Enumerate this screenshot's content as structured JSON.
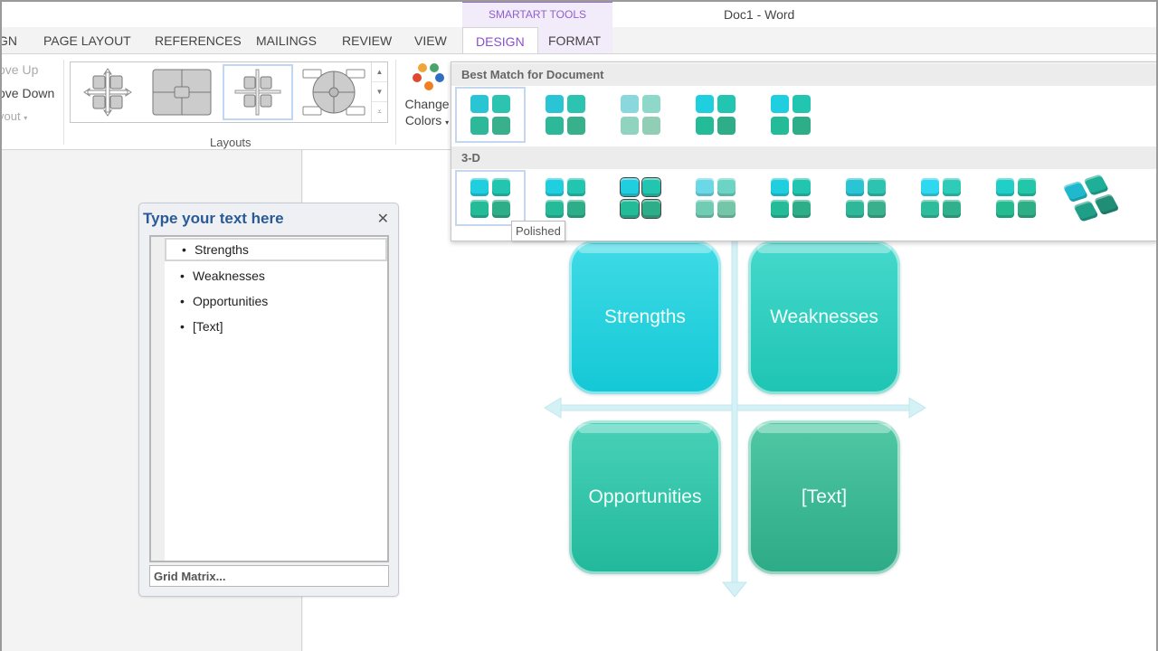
{
  "window": {
    "title": "Doc1 - Word"
  },
  "contextual_tab_group": {
    "label": "SMARTART TOOLS",
    "color": "#8f5fce"
  },
  "tabs": [
    {
      "label": "GN",
      "active": false
    },
    {
      "label": "PAGE LAYOUT",
      "active": false
    },
    {
      "label": "REFERENCES",
      "active": false
    },
    {
      "label": "MAILINGS",
      "active": false
    },
    {
      "label": "REVIEW",
      "active": false
    },
    {
      "label": "VIEW",
      "active": false
    },
    {
      "label": "DESIGN",
      "active": true
    },
    {
      "label": "FORMAT",
      "active": false
    }
  ],
  "ribbon": {
    "create_graphic": {
      "move_up": "ove Up",
      "move_down": "ove Down",
      "layout": "yout"
    },
    "layouts": {
      "label": "Layouts",
      "items": [
        {
          "name": "Cycle Matrix",
          "selected": false
        },
        {
          "name": "Grid layout with center",
          "selected": false
        },
        {
          "name": "Grid Matrix",
          "selected": true
        },
        {
          "name": "Circular layout",
          "selected": false
        }
      ]
    },
    "change_colors": {
      "line1": "Change",
      "line2": "Colors",
      "dot_colors": [
        "#f0a53c",
        "#4aa36b",
        "#dd4a2e",
        "#2f6fbf",
        "#ef7f22"
      ]
    }
  },
  "colors_dropdown": {
    "sections": [
      {
        "title": "Best Match for Document",
        "items": [
          {
            "style": "Flat",
            "selected": true,
            "colors": [
              "#29c5d4",
              "#2cc4b0",
              "#2eb89a",
              "#38b08c"
            ]
          },
          {
            "style": "Flat light",
            "selected": false,
            "colors": [
              "#29c5d4",
              "#2cc4b0",
              "#2eb89a",
              "#38b08c"
            ]
          },
          {
            "style": "Muted",
            "selected": false,
            "colors": [
              "#8ad8de",
              "#8dd8c8",
              "#90d4c0",
              "#92ceb6"
            ]
          },
          {
            "style": "Gradient",
            "selected": false,
            "colors": [
              "#1fcfe0",
              "#22c6b0",
              "#24bb98",
              "#2eae88"
            ]
          },
          {
            "style": "Shadow",
            "selected": false,
            "colors": [
              "#1fcfe0",
              "#22c6b0",
              "#24bb98",
              "#2eae88"
            ]
          }
        ]
      },
      {
        "title": "3-D",
        "items": [
          {
            "style": "Polished",
            "selected": true,
            "colors": [
              "#1fcfe0",
              "#22c6b0",
              "#24bb98",
              "#2eae88"
            ]
          },
          {
            "style": "Inset",
            "selected": false,
            "colors": [
              "#1fcfe0",
              "#22c6b0",
              "#24bb98",
              "#2eae88"
            ]
          },
          {
            "style": "Cartoon",
            "selected": false,
            "colors": [
              "#1fcfe0",
              "#22c6b0",
              "#24bb98",
              "#2eae88"
            ]
          },
          {
            "style": "Powder",
            "selected": false,
            "colors": [
              "#6ad8e6",
              "#6bd4c4",
              "#70ccb2",
              "#74c6a8"
            ]
          },
          {
            "style": "Brick Scene",
            "selected": false,
            "colors": [
              "#1fcfe0",
              "#22c6b0",
              "#24bb98",
              "#2eae88"
            ]
          },
          {
            "style": "Sunset Scene",
            "selected": false,
            "colors": [
              "#29c5d4",
              "#2cc4b0",
              "#2eb89a",
              "#38b08c"
            ]
          },
          {
            "style": "Metallic",
            "selected": false,
            "colors": [
              "#2ed8ee",
              "#2ecbb8",
              "#2ebd9c",
              "#30b08c"
            ]
          },
          {
            "style": "Bevel",
            "selected": false,
            "colors": [
              "#1fcfc8",
              "#22c6a8",
              "#24bb90",
              "#2eae84"
            ]
          },
          {
            "style": "Isometric",
            "selected": false,
            "colors": [
              "#1fb8cc",
              "#1fae98",
              "#1f9e88",
              "#208e76"
            ]
          }
        ]
      }
    ],
    "tooltip": "Polished"
  },
  "text_pane": {
    "title": "Type your text here",
    "items": [
      "Strengths",
      "Weaknesses",
      "Opportunities",
      "[Text]"
    ],
    "selected_index": 0,
    "footer": "Grid Matrix..."
  },
  "smartart": {
    "cells": [
      {
        "label": "Strengths",
        "color_top": "#3fdbe6",
        "color_bottom": "#14c8d6"
      },
      {
        "label": "Weaknesses",
        "color_top": "#45d9cc",
        "color_bottom": "#1fc4b2"
      },
      {
        "label": "Opportunities",
        "color_top": "#48d2b8",
        "color_bottom": "#22b89c"
      },
      {
        "label": "[Text]",
        "color_top": "#50c8a4",
        "color_bottom": "#2daa86"
      }
    ],
    "axis_color": "#cdeef2"
  }
}
